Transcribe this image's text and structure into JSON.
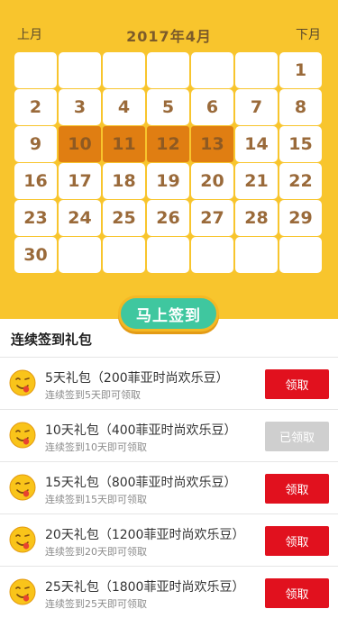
{
  "calendar": {
    "prev_label": "上月",
    "next_label": "下月",
    "month_title": "2017年4月",
    "leading_blank_days": 6,
    "days_in_month": 30,
    "signed_days": [
      10,
      11,
      12,
      13
    ]
  },
  "sign_button_label": "马上签到",
  "gifts": {
    "title": "连续签到礼包",
    "items": [
      {
        "title": "5天礼包（200菲亚时尚欢乐豆）",
        "subtitle": "连续签到5天即可领取",
        "button": "领取",
        "claimed": false
      },
      {
        "title": "10天礼包（400菲亚时尚欢乐豆）",
        "subtitle": "连续签到10天即可领取",
        "button": "已领取",
        "claimed": true
      },
      {
        "title": "15天礼包（800菲亚时尚欢乐豆）",
        "subtitle": "连续签到15天即可领取",
        "button": "领取",
        "claimed": false
      },
      {
        "title": "20天礼包（1200菲亚时尚欢乐豆）",
        "subtitle": "连续签到20天即可领取",
        "button": "领取",
        "claimed": false
      },
      {
        "title": "25天礼包（1800菲亚时尚欢乐豆）",
        "subtitle": "连续签到25天即可领取",
        "button": "领取",
        "claimed": false
      }
    ]
  },
  "colors": {
    "header_bg": "#f8c52d",
    "signed_cell": "#e07e12",
    "sign_button": "#3fc79f",
    "claim_button": "#e1111e",
    "claimed_button": "#cfcfcf"
  }
}
